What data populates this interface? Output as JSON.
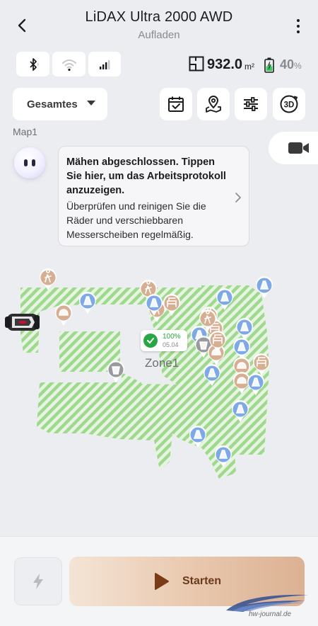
{
  "header": {
    "title": "LiDAX Ultra 2000 AWD",
    "subtitle": "Aufladen"
  },
  "status": {
    "area_value": "932.0",
    "area_unit": "m²",
    "battery_value": "40",
    "battery_unit": "%",
    "battery_level": 0.4
  },
  "toolbar": {
    "map_select_label": "Gesamtes",
    "map_name": "Map1",
    "icons": [
      "calendar-check-icon",
      "map-pin-icon",
      "sliders-icon",
      "3d-view-icon"
    ]
  },
  "assistant": {
    "title": "Mähen abgeschlossen. Tippen Sie hier, um das Arbeitsprotokoll anzuzeigen.",
    "body": "Überprüfen und reinigen Sie die Räder und verschiebbaren Messerscheiben regelmäßig."
  },
  "map": {
    "zone_label": "Zone1",
    "progress_percent": "100%",
    "progress_date": "05.04"
  },
  "actions": {
    "start_label": "Starten"
  },
  "watermark": {
    "text": "hw-journal.de"
  },
  "colors": {
    "lawn_stripe": "#9fd98f",
    "lawn_bg": "#e7f4e1",
    "accent_brown": "#7a3b17",
    "marker_blue": "#7ea9e6",
    "marker_tan": "#d6ae92",
    "progress_green": "#27a745"
  }
}
